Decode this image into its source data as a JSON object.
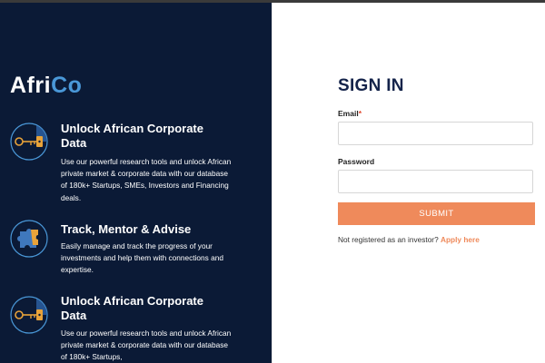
{
  "brand": {
    "part1": "Afri",
    "part2": "Co"
  },
  "features": [
    {
      "icon": "key-icon",
      "title": "Unlock African Corporate Data",
      "description": "Use our powerful research tools and unlock African private market & corporate data with our database of 180k+ Startups, SMEs, Investors and Financing deals."
    },
    {
      "icon": "puzzle-icon",
      "title": "Track, Mentor & Advise",
      "description": "Easily manage and track the progress of your investments and help them with connections and expertise."
    },
    {
      "icon": "key-icon",
      "title": "Unlock African Corporate Data",
      "description": "Use our powerful research tools and unlock African private market & corporate data with our database of 180k+ Startups,"
    }
  ],
  "form": {
    "heading": "SIGN IN",
    "email_label": "Email",
    "email_required_mark": "*",
    "email_value": "",
    "password_label": "Password",
    "password_value": "",
    "submit_label": "SUBMIT",
    "note_text": "Not registered as an investor? ",
    "note_link": "Apply here"
  },
  "colors": {
    "panel_bg": "#0b1a36",
    "accent": "#ef8a5b",
    "brand_blue": "#4a98d8",
    "heading": "#14234a"
  }
}
